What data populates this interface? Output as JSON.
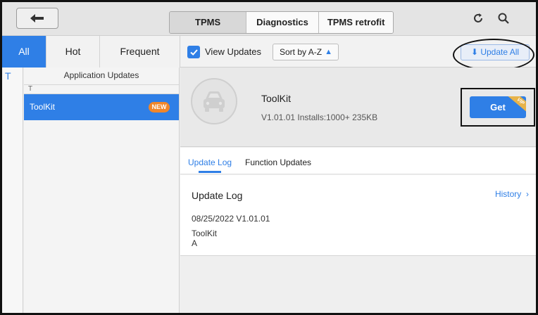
{
  "header": {
    "tabs": [
      {
        "label": "TPMS",
        "active": true
      },
      {
        "label": "Diagnostics",
        "active": false
      },
      {
        "label": "TPMS retrofit",
        "active": false
      }
    ],
    "icons": [
      "back-arrow-icon",
      "refresh-icon",
      "search-icon"
    ]
  },
  "categories": [
    {
      "label": "All",
      "active": true
    },
    {
      "label": "Hot",
      "active": false
    },
    {
      "label": "Frequent",
      "active": false
    }
  ],
  "filter": {
    "view_updates_label": "View Updates",
    "view_updates_checked": true,
    "sort_label": "Sort by A-Z",
    "update_all_label": "Update All"
  },
  "sidebar": {
    "alpha_index": "T",
    "list_title": "Application Updates",
    "group_letter": "T",
    "items": [
      {
        "name": "ToolKit",
        "badge": "NEW",
        "selected": true
      }
    ]
  },
  "detail": {
    "name": "ToolKit",
    "meta": "V1.01.01  Installs:1000+  235KB",
    "get_label": "Get",
    "vip_label": "VIP"
  },
  "log_tabs": [
    {
      "label": "Update Log",
      "active": true
    },
    {
      "label": "Function Updates",
      "active": false
    }
  ],
  "update_log": {
    "title": "Update Log",
    "history_label": "History",
    "date_version": "08/25/2022  V1.01.01",
    "line1": "ToolKit",
    "line2": "A"
  },
  "colors": {
    "accent": "#2f7fe6",
    "badge": "#f0862a",
    "vip": "#e7b34a"
  }
}
